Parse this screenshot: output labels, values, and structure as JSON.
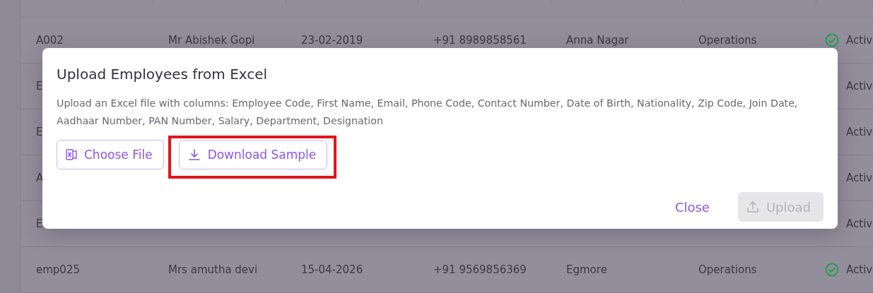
{
  "table": {
    "rows": [
      {
        "code": "A002",
        "name": "Mr Abishek Gopi",
        "date": "23-02-2019",
        "phone": "+91 8989858561",
        "area": "Anna Nagar",
        "department": "Operations",
        "status": "Activ",
        "active": true
      },
      {
        "code": "E",
        "status": "Activ"
      },
      {
        "code": "E",
        "status": "Activ"
      },
      {
        "code": "A",
        "status": "Activ"
      },
      {
        "code": "E",
        "status": "Activ"
      },
      {
        "code": "emp025",
        "name": "Mrs amutha devi",
        "date": "15-04-2026",
        "phone": "+91 9569856369",
        "area": "Egmore",
        "department": "Operations",
        "status": "Activ",
        "active": true
      }
    ]
  },
  "dialog": {
    "title": "Upload Employees from Excel",
    "description": "Upload an Excel file with columns: Employee Code, First Name, Email, Phone Code, Contact Number, Date of Birth, Nationality, Zip Code, Join Date, Aadhaar Number, PAN Number, Salary, Department, Designation",
    "actions": [
      {
        "label": "Choose File",
        "kind": "file",
        "highlighted": false
      },
      {
        "label": "Download Sample",
        "kind": "download",
        "highlighted": true
      }
    ],
    "footer": [
      {
        "label": "Close",
        "kind": "text",
        "disabled": false
      },
      {
        "label": "Upload",
        "kind": "upload",
        "disabled": true
      }
    ]
  }
}
